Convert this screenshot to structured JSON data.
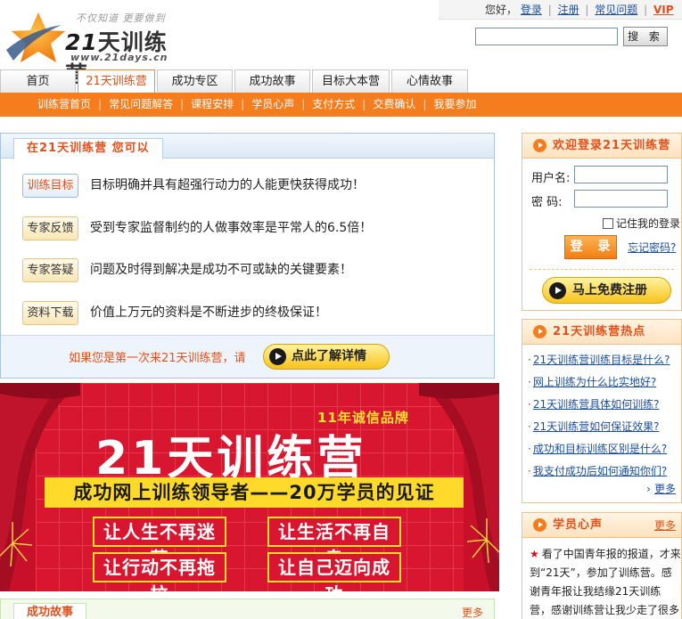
{
  "header": {
    "slogan": "不仅知道  更要做到",
    "logo_num": "21",
    "logo_text": "天训练营",
    "domain": "www.21days.cn",
    "greeting": "您好，",
    "login_link": "登录",
    "register_link": "注册",
    "faq_link": "常见问题",
    "vip_link": "VIP",
    "search_button": "搜 索",
    "search_value": ""
  },
  "main_nav": [
    "首页",
    "21天训练营",
    "成功专区",
    "成功故事",
    "目标大本营",
    "心情故事"
  ],
  "main_nav_active": 1,
  "sub_nav": [
    "训练营首页",
    "常见问题解答",
    "课程安排",
    "学员心声",
    "支付方式",
    "交费确认",
    "我要参加"
  ],
  "intro": {
    "title": "在21天训练营  您可以",
    "features": [
      {
        "label": "训练目标",
        "text": "目标明确并具有超强行动力的人能更快获得成功！"
      },
      {
        "label": "专家反馈",
        "text": "受到专家监督制约的人做事效率是平常人的6.5倍！"
      },
      {
        "label": "专家答疑",
        "text": "问题及时得到解决是成功不可或缺的关键要素！"
      },
      {
        "label": "资料下载",
        "text": "价值上万元的资料是不断进步的终极保证！"
      }
    ],
    "footer_text": "如果您是第一次来21天训练营，请",
    "learn_button": "点此了解详情"
  },
  "banner": {
    "brand": "11年诚信品牌",
    "title": "21天训练营",
    "tagline": "成功网上训练领导者——20万学员的见证",
    "slogans": [
      "让人生不再迷茫",
      "让生活不再自卑",
      "让行动不再拖拉",
      "让自己迈向成功"
    ]
  },
  "story_bar": {
    "title": "成功故事",
    "more": "更多"
  },
  "login_box": {
    "title": "欢迎登录21天训练营",
    "username_label": "用户名:",
    "password_label": "密  码:",
    "remember_label": "记住我的登录",
    "login_button": "登 录",
    "forgot_link": "忘记密码?",
    "register_button": "马上免费注册"
  },
  "hot_box": {
    "title": "21天训练营热点",
    "items": [
      "21天训练营训练目标是什么?",
      "网上训练为什么比实地好?",
      "21天训练营具体如何训练?",
      "21天训练营如何保证效果?",
      "成功和目标训练区别是什么?",
      "我支付成功后如何通知你们?"
    ],
    "more": "更多"
  },
  "voice_box": {
    "title": "学员心声",
    "more": "更多",
    "text": "看了中国青年报的报道，才来到“21天”，参加了训练营。感谢青年报让我结缘21天训练营，感谢训练营让我少走了很多弯路，节省了人生最宝贵的时"
  },
  "colors": {
    "accent_orange": "#f57d1e",
    "accent_red": "#e4501b",
    "link_blue": "#1c4fa1",
    "banner_red": "#d8162f",
    "banner_yellow": "#ffda2a"
  }
}
